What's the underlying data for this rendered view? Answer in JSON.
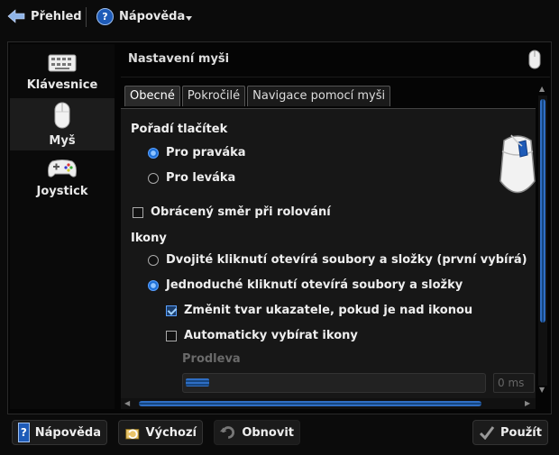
{
  "topbar": {
    "back_label": "Přehled",
    "help_label": "Nápověda"
  },
  "sidebar": {
    "items": [
      {
        "label": "Klávesnice",
        "icon": "keyboard-icon",
        "active": false
      },
      {
        "label": "Myš",
        "icon": "mouse-icon",
        "active": true
      },
      {
        "label": "Joystick",
        "icon": "gamepad-icon",
        "active": false
      }
    ]
  },
  "header": {
    "title": "Nastavení myši"
  },
  "tabs": [
    {
      "label": "Obecné",
      "active": true
    },
    {
      "label": "Pokročilé",
      "active": false
    },
    {
      "label": "Navigace pomocí myši",
      "active": false
    }
  ],
  "general": {
    "button_order": {
      "title": "Pořadí tlačítek",
      "right_handed": "Pro praváka",
      "left_handed": "Pro leváka",
      "selected": "right_handed"
    },
    "reverse_scroll": {
      "label": "Obrácený směr při rolování",
      "checked": false
    },
    "icons": {
      "title": "Ikony",
      "double_click": "Dvojité kliknutí otevírá soubory a složky (první vybírá)",
      "single_click": "Jednoduché kliknutí otevírá soubory a složky",
      "selected": "single_click",
      "change_pointer": {
        "label": "Změnit tvar ukazatele, pokud je nad ikonou",
        "checked": true
      },
      "auto_select": {
        "label": "Automaticky vybírat ikony",
        "checked": false
      },
      "delay_label": "Prodleva",
      "delay_value": "0 ms"
    }
  },
  "buttons": {
    "help": "Nápověda",
    "defaults": "Výchozí",
    "reset": "Obnovit",
    "apply": "Použít"
  },
  "colors": {
    "accent": "#2f6ec4",
    "background": "#0b0b0b"
  }
}
